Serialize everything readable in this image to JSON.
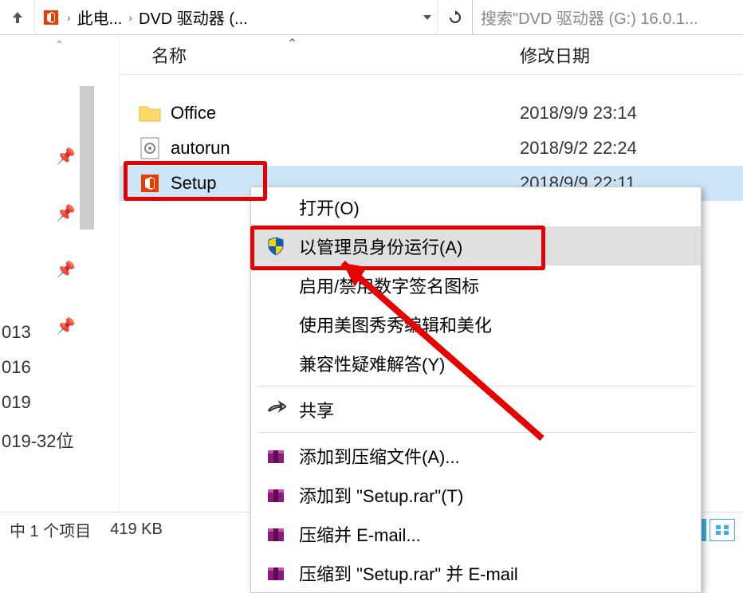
{
  "breadcrumb": {
    "item1": "此电...",
    "item2": "DVD 驱动器 (..."
  },
  "search": {
    "placeholder": "搜索\"DVD 驱动器 (G:) 16.0.1..."
  },
  "columns": {
    "name": "名称",
    "date": "修改日期"
  },
  "files": [
    {
      "name": "Office",
      "date": "2018/9/9 23:14",
      "icon": "folder"
    },
    {
      "name": "autorun",
      "date": "2018/9/2 22:24",
      "icon": "inf"
    },
    {
      "name": "Setup",
      "date": "2018/9/9 22:11",
      "icon": "office"
    }
  ],
  "left_items": [
    "013",
    "016",
    "019",
    "019-32位"
  ],
  "context_menu": {
    "open": "打开(O)",
    "run_admin": "以管理员身份运行(A)",
    "enable_sig": "启用/禁用数字签名图标",
    "meitu": "使用美图秀秀编辑和美化",
    "compat": "兼容性疑难解答(Y)",
    "share": "共享",
    "add_compress": "添加到压缩文件(A)...",
    "add_rar": "添加到 \"Setup.rar\"(T)",
    "compress_email": "压缩并 E-mail...",
    "compress_rar_email": "压缩到 \"Setup.rar\" 并 E-mail"
  },
  "status": {
    "selected": "中 1 个项目",
    "size": "419 KB"
  }
}
